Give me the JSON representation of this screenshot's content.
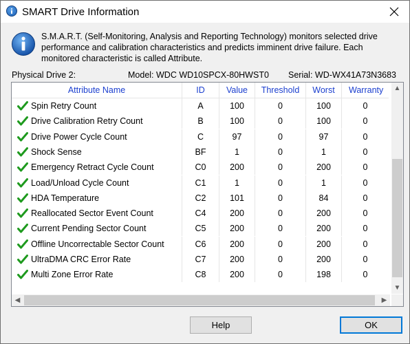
{
  "window": {
    "title": "SMART Drive Information",
    "title_icon": "info-icon",
    "close_icon": "close-icon"
  },
  "info": {
    "icon": "info-icon",
    "text": "S.M.A.R.T. (Self-Monitoring, Analysis and Reporting Technology) monitors selected drive performance and calibration characteristics and predicts imminent drive failure. Each monitored characteristic is called Attribute."
  },
  "drive": {
    "label": "Physical Drive 2:",
    "model": "Model: WDC WD10SPCX-80HWST0",
    "serial": "Serial: WD-WX41A73N3683"
  },
  "table": {
    "columns": [
      "Attribute Name",
      "ID",
      "Value",
      "Threshold",
      "Worst",
      "Warranty"
    ],
    "status_icon": "green-check-icon",
    "rows": [
      {
        "name": "Spin Retry Count",
        "id": "A",
        "value": "100",
        "threshold": "0",
        "worst": "100",
        "warranty": "0"
      },
      {
        "name": "Drive Calibration Retry Count",
        "id": "B",
        "value": "100",
        "threshold": "0",
        "worst": "100",
        "warranty": "0"
      },
      {
        "name": "Drive Power Cycle Count",
        "id": "C",
        "value": "97",
        "threshold": "0",
        "worst": "97",
        "warranty": "0"
      },
      {
        "name": "Shock Sense",
        "id": "BF",
        "value": "1",
        "threshold": "0",
        "worst": "1",
        "warranty": "0"
      },
      {
        "name": "Emergency Retract Cycle Count",
        "id": "C0",
        "value": "200",
        "threshold": "0",
        "worst": "200",
        "warranty": "0"
      },
      {
        "name": "Load/Unload Cycle Count",
        "id": "C1",
        "value": "1",
        "threshold": "0",
        "worst": "1",
        "warranty": "0"
      },
      {
        "name": "HDA Temperature",
        "id": "C2",
        "value": "101",
        "threshold": "0",
        "worst": "84",
        "warranty": "0"
      },
      {
        "name": "Reallocated Sector Event Count",
        "id": "C4",
        "value": "200",
        "threshold": "0",
        "worst": "200",
        "warranty": "0"
      },
      {
        "name": "Current Pending Sector Count",
        "id": "C5",
        "value": "200",
        "threshold": "0",
        "worst": "200",
        "warranty": "0"
      },
      {
        "name": "Offline Uncorrectable Sector Count",
        "id": "C6",
        "value": "200",
        "threshold": "0",
        "worst": "200",
        "warranty": "0"
      },
      {
        "name": "UltraDMA CRC Error Rate",
        "id": "C7",
        "value": "200",
        "threshold": "0",
        "worst": "200",
        "warranty": "0"
      },
      {
        "name": "Multi Zone Error Rate",
        "id": "C8",
        "value": "200",
        "threshold": "0",
        "worst": "198",
        "warranty": "0"
      }
    ]
  },
  "buttons": {
    "help": "Help",
    "ok": "OK"
  },
  "colors": {
    "header_text": "#1b3fcf",
    "check": "#1e9a1e",
    "accent": "#0078d7"
  }
}
